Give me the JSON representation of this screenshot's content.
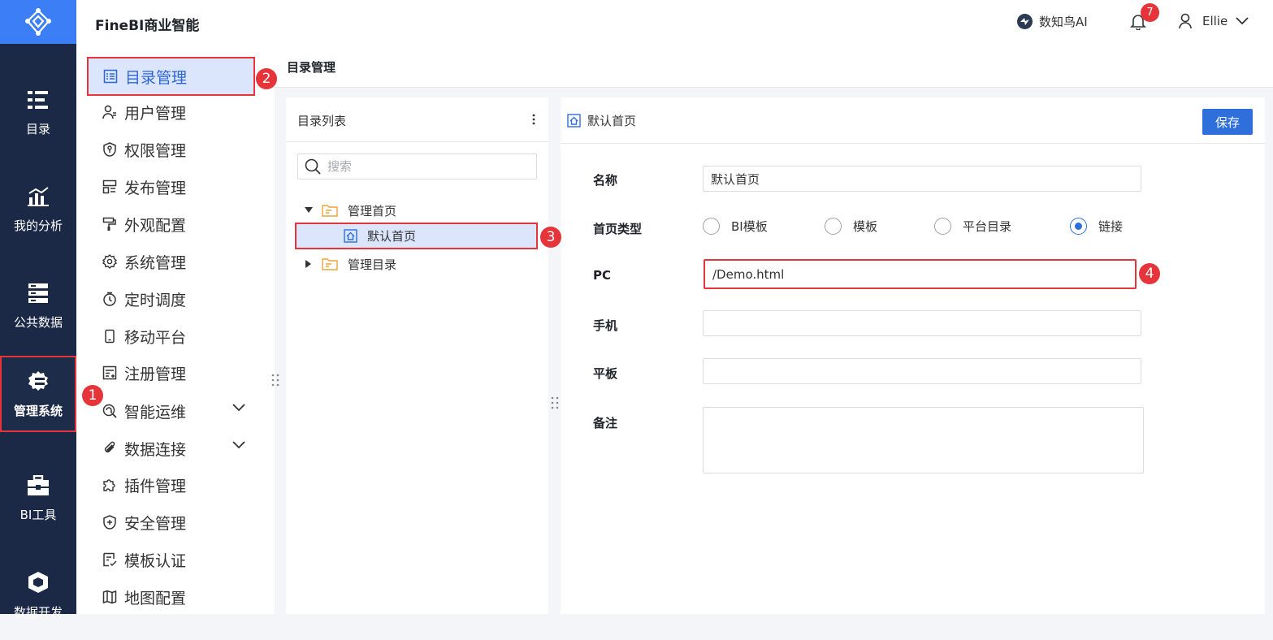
{
  "header": {
    "brand": "FineBI商业智能",
    "ai_label": "数知鸟AI",
    "notification_count": "7",
    "user_name": "Ellie"
  },
  "rail": {
    "items": [
      {
        "label": "目录",
        "icon": "catalog-icon"
      },
      {
        "label": "我的分析",
        "icon": "analysis-chart-icon"
      },
      {
        "label": "公共数据",
        "icon": "public-data-icon"
      },
      {
        "label": "管理系统",
        "icon": "management-gear-icon"
      },
      {
        "label": "BI工具",
        "icon": "toolbox-icon"
      },
      {
        "label": "数据开发",
        "icon": "cube-icon"
      }
    ]
  },
  "submenu": {
    "items": [
      {
        "label": "目录管理",
        "icon": "list-icon"
      },
      {
        "label": "用户管理",
        "icon": "user-icon"
      },
      {
        "label": "权限管理",
        "icon": "shield-key-icon"
      },
      {
        "label": "发布管理",
        "icon": "publish-icon"
      },
      {
        "label": "外观配置",
        "icon": "paint-roller-icon"
      },
      {
        "label": "系统管理",
        "icon": "gear-icon"
      },
      {
        "label": "定时调度",
        "icon": "timer-icon"
      },
      {
        "label": "移动平台",
        "icon": "mobile-icon"
      },
      {
        "label": "注册管理",
        "icon": "register-icon"
      },
      {
        "label": "智能运维",
        "icon": "ops-icon"
      },
      {
        "label": "数据连接",
        "icon": "paperclip-icon"
      },
      {
        "label": "插件管理",
        "icon": "puzzle-icon"
      },
      {
        "label": "安全管理",
        "icon": "shield-plus-icon"
      },
      {
        "label": "模板认证",
        "icon": "certificate-icon"
      },
      {
        "label": "地图配置",
        "icon": "map-icon"
      }
    ]
  },
  "content": {
    "title": "目录管理"
  },
  "catalog": {
    "title": "目录列表",
    "search_placeholder": "搜索",
    "tree": [
      {
        "label": "管理首页"
      },
      {
        "label": "默认首页"
      },
      {
        "label": "管理目录"
      }
    ]
  },
  "detail": {
    "title": "默认首页",
    "save_label": "保存",
    "name_label": "名称",
    "name_value": "默认首页",
    "type_label": "首页类型",
    "type_options": [
      "BI模板",
      "模板",
      "平台目录",
      "链接"
    ],
    "selected_type": "链接",
    "pc_label": "PC",
    "pc_value": "/Demo.html",
    "mobile_label": "手机",
    "mobile_value": "",
    "tablet_label": "平板",
    "tablet_value": "",
    "remark_label": "备注",
    "remark_value": ""
  },
  "markers": [
    "1",
    "2",
    "3",
    "4"
  ],
  "colors": {
    "rail_bg": "#1b2946",
    "logo_bg": "#3b7ef5",
    "primary": "#2f6fdc",
    "highlight": "#e5343a",
    "selected_bg": "#dbe5fb"
  }
}
